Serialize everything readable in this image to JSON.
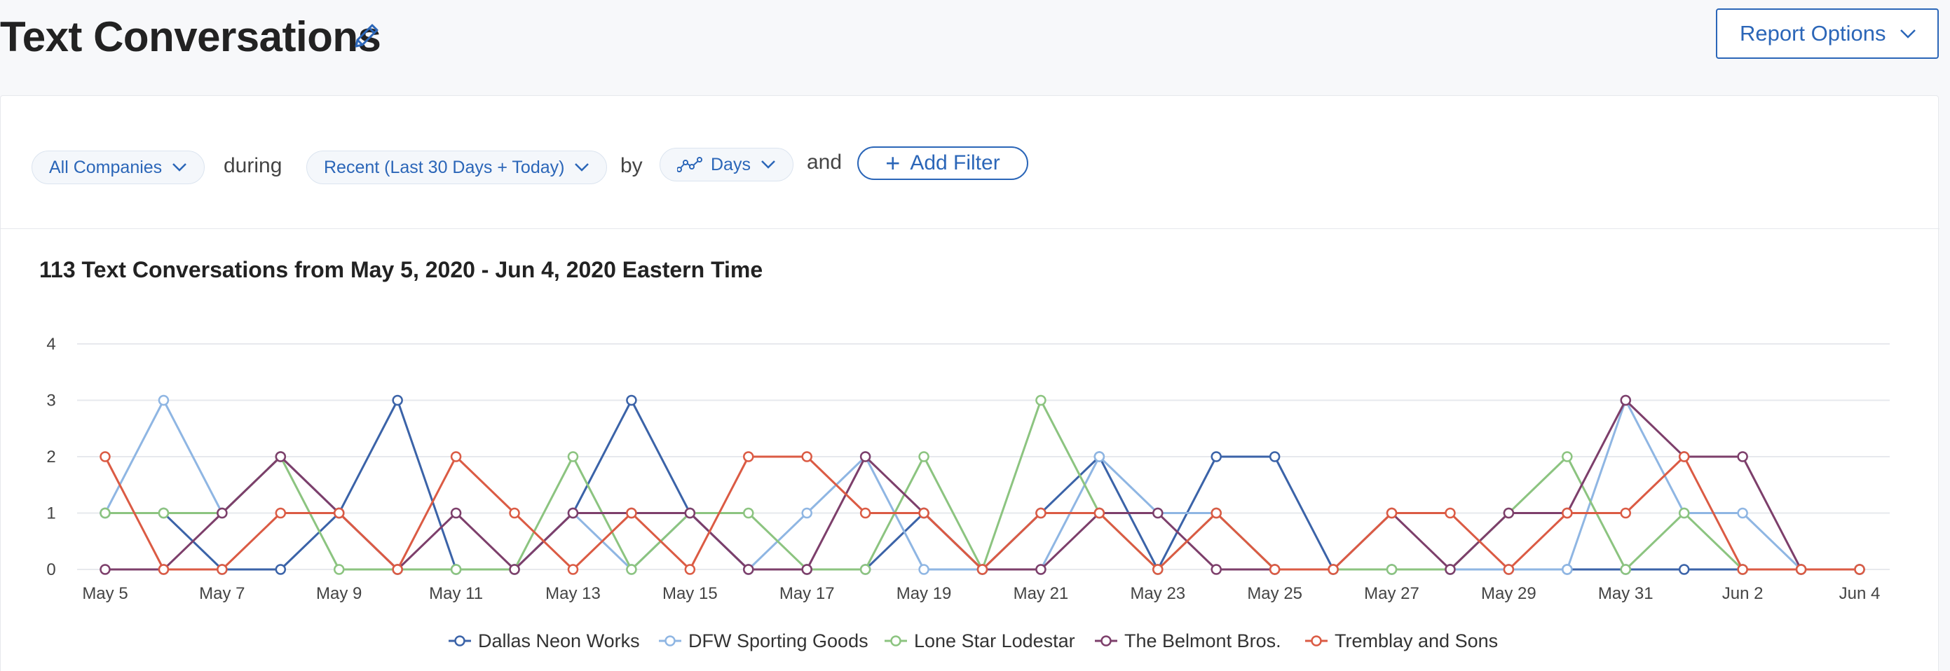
{
  "header": {
    "title": "Text Conversations",
    "report_options_label": "Report Options"
  },
  "filters": {
    "company": "All Companies",
    "during_word": "during",
    "range": "Recent (Last 30 Days + Today)",
    "by_word": "by",
    "interval": "Days",
    "and_word": "and",
    "add_filter": "Add Filter"
  },
  "colors": {
    "accent": "#2b66b8",
    "series": [
      "#3b63a8",
      "#8fb6e3",
      "#8cc480",
      "#7d3f6b",
      "#db5b44"
    ]
  },
  "chart_data": {
    "type": "line",
    "title": "113 Text Conversations from May 5, 2020 - Jun 4, 2020 Eastern Time",
    "xlabel": "",
    "ylabel": "",
    "ylim": [
      0,
      4
    ],
    "yticks": [
      "0",
      "1",
      "2",
      "3",
      "4"
    ],
    "grid": true,
    "legend_position": "bottom",
    "x": [
      "May 5",
      "May 6",
      "May 7",
      "May 8",
      "May 9",
      "May 10",
      "May 11",
      "May 12",
      "May 13",
      "May 14",
      "May 15",
      "May 16",
      "May 17",
      "May 18",
      "May 19",
      "May 20",
      "May 21",
      "May 22",
      "May 23",
      "May 24",
      "May 25",
      "May 26",
      "May 27",
      "May 28",
      "May 29",
      "May 30",
      "May 31",
      "Jun 1",
      "Jun 2",
      "Jun 3",
      "Jun 4"
    ],
    "xtick_labels": [
      "May 5",
      "May 7",
      "May 9",
      "May 11",
      "May 13",
      "May 15",
      "May 17",
      "May 19",
      "May 21",
      "May 23",
      "May 25",
      "May 27",
      "May 29",
      "May 31",
      "Jun 2",
      "Jun 4"
    ],
    "series": [
      {
        "name": "Dallas Neon Works",
        "values": [
          1,
          1,
          0,
          0,
          1,
          3,
          0,
          0,
          1,
          3,
          1,
          0,
          0,
          0,
          1,
          0,
          1,
          2,
          0,
          2,
          2,
          0,
          0,
          0,
          0,
          0,
          0,
          0,
          0,
          0,
          0
        ]
      },
      {
        "name": "DFW Sporting Goods",
        "values": [
          1,
          3,
          1,
          2,
          1,
          0,
          0,
          0,
          1,
          0,
          1,
          0,
          1,
          2,
          0,
          0,
          0,
          2,
          1,
          1,
          0,
          0,
          0,
          0,
          0,
          0,
          3,
          1,
          1,
          0,
          0
        ]
      },
      {
        "name": "Lone Star Lodestar",
        "values": [
          1,
          1,
          1,
          2,
          0,
          0,
          0,
          0,
          2,
          0,
          1,
          1,
          0,
          0,
          2,
          0,
          3,
          1,
          0,
          1,
          0,
          0,
          0,
          0,
          1,
          2,
          0,
          1,
          0,
          0,
          0
        ]
      },
      {
        "name": "The Belmont Bros.",
        "values": [
          0,
          0,
          1,
          2,
          1,
          0,
          1,
          0,
          1,
          1,
          1,
          0,
          0,
          2,
          1,
          0,
          0,
          1,
          1,
          0,
          0,
          0,
          1,
          0,
          1,
          1,
          3,
          2,
          2,
          0,
          0
        ]
      },
      {
        "name": "Tremblay and Sons",
        "values": [
          2,
          0,
          0,
          1,
          1,
          0,
          2,
          1,
          0,
          1,
          0,
          2,
          2,
          1,
          1,
          0,
          1,
          1,
          0,
          1,
          0,
          0,
          1,
          1,
          0,
          1,
          1,
          2,
          0,
          0,
          0
        ]
      }
    ]
  }
}
